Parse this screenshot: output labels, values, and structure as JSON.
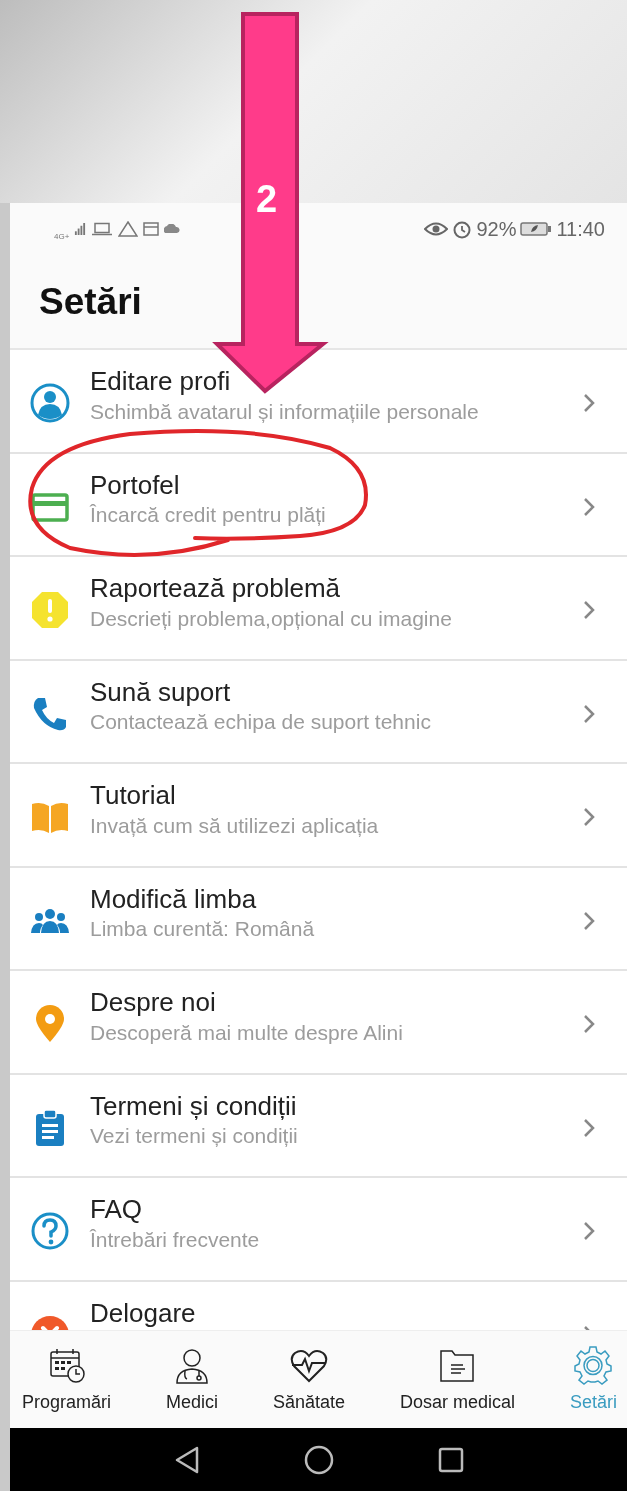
{
  "status_bar": {
    "network": "4G+",
    "battery": "92%",
    "time": "11:40"
  },
  "header": {
    "title": "Setări"
  },
  "settings": [
    {
      "kind": "profile",
      "title": "Editare profi",
      "subtitle": "Schimbă avatarul și informațiile personale"
    },
    {
      "kind": "wallet",
      "title": "Portofel",
      "subtitle": "Încarcă credit pentru plăți"
    },
    {
      "kind": "warning",
      "title": "Raportează problemă",
      "subtitle": "Descrieți problema,opțional cu imagine"
    },
    {
      "kind": "phone",
      "title": "Sună suport",
      "subtitle": "Contactează echipa de suport tehnic"
    },
    {
      "kind": "book",
      "title": "Tutorial",
      "subtitle": "Invață cum să utilizezi aplicația"
    },
    {
      "kind": "people",
      "title": "Modifică limba",
      "subtitle": "Limba curentă: Română"
    },
    {
      "kind": "pin",
      "title": "Despre noi",
      "subtitle": "Descoperă mai multe despre Alini"
    },
    {
      "kind": "clipboard",
      "title": "Termeni și condiții",
      "subtitle": "Vezi termeni și condiții"
    },
    {
      "kind": "faq",
      "title": "FAQ",
      "subtitle": "Întrebări frecvente"
    },
    {
      "kind": "logout",
      "title": "Delogare"
    }
  ],
  "bottom_nav": [
    {
      "kind": "calendar",
      "label": "Programări",
      "selected": false
    },
    {
      "kind": "doctor",
      "label": "Medici",
      "selected": false
    },
    {
      "kind": "heart",
      "label": "Sănătate",
      "selected": false
    },
    {
      "kind": "folder",
      "label": "Dosar medical",
      "selected": false
    },
    {
      "kind": "gear",
      "label": "Setări",
      "selected": true
    }
  ],
  "annotation": {
    "step_label": "2"
  }
}
